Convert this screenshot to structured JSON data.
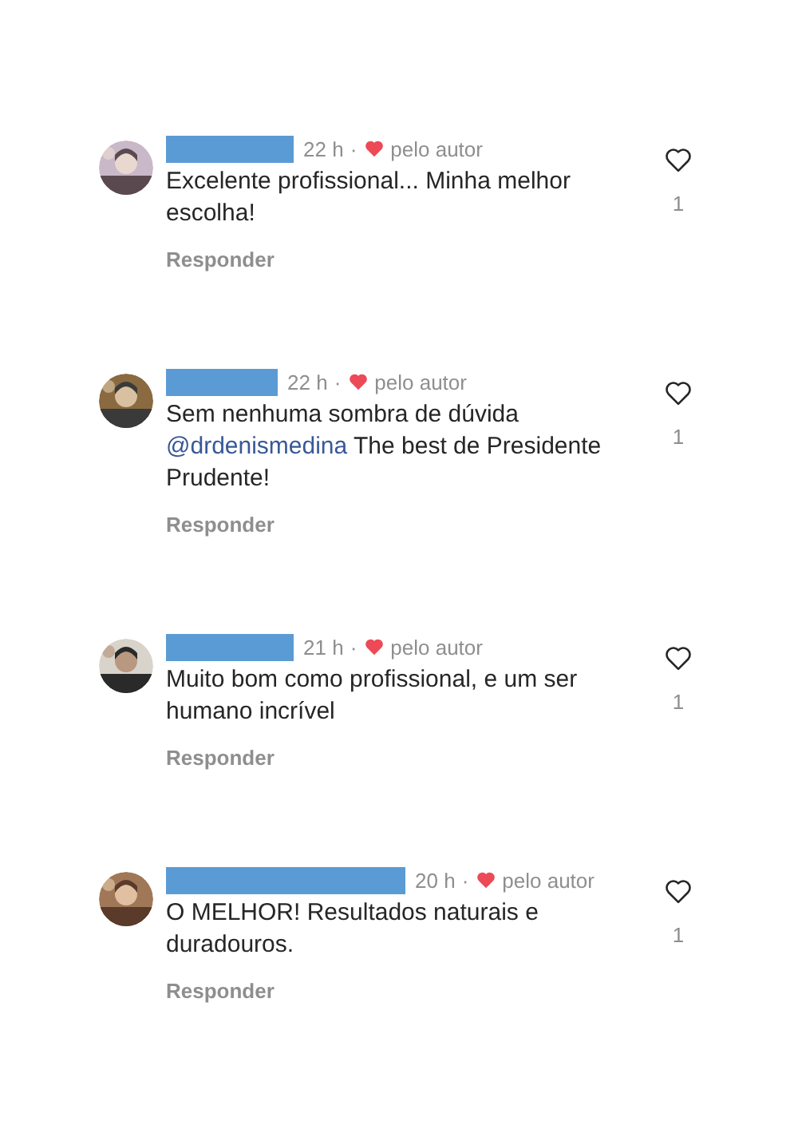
{
  "comments": [
    {
      "time": "22 h",
      "separator": "·",
      "author_liked": true,
      "author_label": "pelo autor",
      "body": [
        {
          "kind": "text",
          "text": "Excelente profissional... Minha melhor escolha!"
        }
      ],
      "reply": "Responder",
      "liked": false,
      "like_count": "1"
    },
    {
      "time": "22 h",
      "separator": "·",
      "author_liked": true,
      "author_label": "pelo autor",
      "body": [
        {
          "kind": "text",
          "text": "Sem nenhuma sombra de dúvida "
        },
        {
          "kind": "mention",
          "text": "@drdenismedina"
        },
        {
          "kind": "text",
          "text": " The best de Presidente Prudente!"
        }
      ],
      "reply": "Responder",
      "liked": false,
      "like_count": "1"
    },
    {
      "time": "21 h",
      "separator": "·",
      "author_liked": true,
      "author_label": "pelo autor",
      "body": [
        {
          "kind": "text",
          "text": "Muito bom como profissional, e um ser humano incrível"
        }
      ],
      "reply": "Responder",
      "liked": false,
      "like_count": "1"
    },
    {
      "time": "20 h",
      "separator": "·",
      "author_liked": true,
      "author_label": "pelo autor",
      "body": [
        {
          "kind": "text",
          "text": "O MELHOR! Resultados naturais e duradouros."
        }
      ],
      "reply": "Responder",
      "liked": false,
      "like_count": "1"
    }
  ]
}
